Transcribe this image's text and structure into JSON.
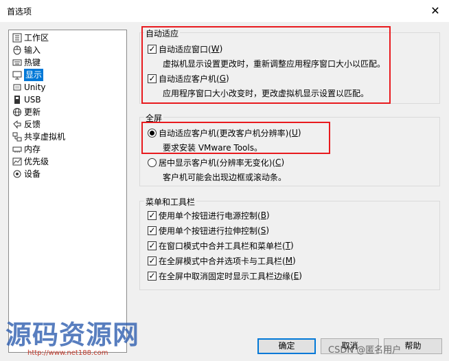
{
  "window": {
    "title": "首选项",
    "close": "✕"
  },
  "sidebar": {
    "items": [
      {
        "label": "工作区"
      },
      {
        "label": "输入"
      },
      {
        "label": "热键"
      },
      {
        "label": "显示"
      },
      {
        "label": "Unity"
      },
      {
        "label": "USB"
      },
      {
        "label": "更新"
      },
      {
        "label": "反馈"
      },
      {
        "label": "共享虚拟机"
      },
      {
        "label": "内存"
      },
      {
        "label": "优先级"
      },
      {
        "label": "设备"
      }
    ],
    "selected": "显示"
  },
  "autofit": {
    "title": "自动适应",
    "window": {
      "label": "自动适应窗口(",
      "key": "W",
      "end": ")",
      "checked": true,
      "desc": "虚拟机显示设置更改时，重新调整应用程序窗口大小以匹配。"
    },
    "guest": {
      "label": "自动适应客户机(",
      "key": "G",
      "end": ")",
      "checked": true,
      "desc": "应用程序窗口大小改变时，更改虚拟机显示设置以匹配。"
    }
  },
  "fullscreen": {
    "title": "全屏",
    "opt1": {
      "label": "自动适应客户机(更改客户机分辨率)(",
      "key": "U",
      "end": ")",
      "selected": true,
      "desc": "要求安装 VMware Tools。"
    },
    "opt2": {
      "label": "居中显示客户机(分辨率无变化)(",
      "key": "C",
      "end": ")",
      "selected": false,
      "desc": "客户机可能会出现边框或滚动条。"
    }
  },
  "menu_toolbar": {
    "title": "菜单和工具栏",
    "items": [
      {
        "label": "使用单个按钮进行电源控制(",
        "key": "B",
        "end": ")",
        "checked": true
      },
      {
        "label": "使用单个按钮进行拉伸控制(",
        "key": "S",
        "end": ")",
        "checked": true
      },
      {
        "label": "在窗口模式中合并工具栏和菜单栏(",
        "key": "T",
        "end": ")",
        "checked": true
      },
      {
        "label": "在全屏模式中合并选项卡与工具栏(",
        "key": "M",
        "end": ")",
        "checked": true
      },
      {
        "label": "在全屏中取消固定时显示工具栏边缘(",
        "key": "E",
        "end": ")",
        "checked": true
      }
    ]
  },
  "buttons": {
    "ok": "确定",
    "cancel": "取消",
    "help": "帮助"
  },
  "watermarks": {
    "main": "源码资源网",
    "url": "http://www.net188.com",
    "csdn": "CSDN @匿名用户"
  },
  "colors": {
    "accent": "#0078d7",
    "highlight_border": "#e8191d"
  }
}
